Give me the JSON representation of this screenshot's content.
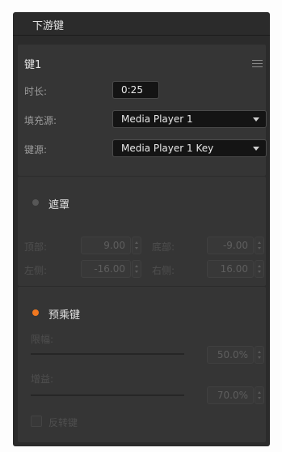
{
  "title": "下游键",
  "key": {
    "name": "键1",
    "rate_label": "时长:",
    "rate_value": "0:25",
    "fill_label": "填充源:",
    "fill_value": "Media Player 1",
    "key_label": "键源:",
    "key_value": "Media Player 1 Key"
  },
  "mask": {
    "title": "遮罩",
    "enabled": false,
    "top_label": "顶部:",
    "top_value": "9.00",
    "bottom_label": "底部:",
    "bottom_value": "-9.00",
    "left_label": "左侧:",
    "left_value": "-16.00",
    "right_label": "右侧:",
    "right_value": "16.00"
  },
  "premultiply": {
    "title": "预乘键",
    "enabled": true,
    "clip_label": "限幅:",
    "clip_value": "50.0%",
    "gain_label": "增益:",
    "gain_value": "70.0%",
    "invert_label": "反转键"
  },
  "colors": {
    "accent": "#f07820",
    "panel": "#353535",
    "background": "#2b2b2b"
  }
}
